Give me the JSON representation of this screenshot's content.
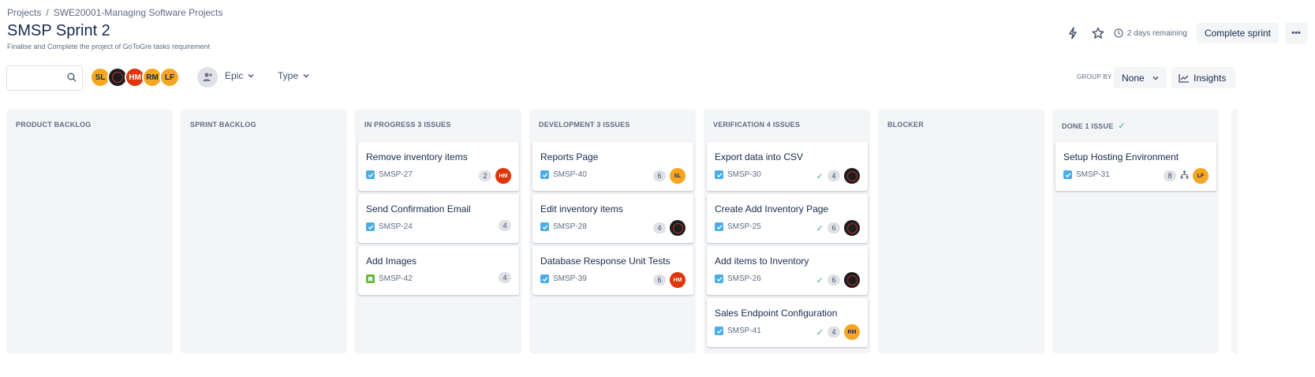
{
  "breadcrumb": {
    "items": [
      "Projects",
      "SWE20001-Managing Software Projects"
    ],
    "separator": "/"
  },
  "sprint": {
    "title": "SMSP Sprint 2",
    "goal": "Finalise and Complete the project of GoToGre tasks requirement"
  },
  "header_actions": {
    "remaining": "2 days remaining",
    "complete_label": "Complete sprint",
    "more_label": "•••"
  },
  "toolbar": {
    "search_placeholder": "",
    "avatars": [
      {
        "initials": "SL",
        "color": "#f6a623"
      },
      {
        "initials": "",
        "color": "#1d1d1d"
      },
      {
        "initials": "HM",
        "color": "#de350b"
      },
      {
        "initials": "RM",
        "color": "#f6a623"
      },
      {
        "initials": "LF",
        "color": "#f6a623"
      }
    ],
    "filter_epic": "Epic",
    "filter_type": "Type",
    "group_by_label": "GROUP BY",
    "group_by_value": "None",
    "insights_label": "Insights"
  },
  "columns": [
    {
      "name": "PRODUCT BACKLOG",
      "cards": []
    },
    {
      "name": "SPRINT BACKLOG",
      "cards": []
    },
    {
      "name": "IN PROGRESS 3 ISSUES",
      "cards": [
        {
          "title": "Remove inventory items",
          "key": "SMSP-27",
          "type": "task",
          "points": "2",
          "assignee": "HM",
          "done": false
        },
        {
          "title": "Send Confirmation Email",
          "key": "SMSP-24",
          "type": "task",
          "points": "4",
          "assignee": "",
          "done": false
        },
        {
          "title": "Add Images",
          "key": "SMSP-42",
          "type": "story",
          "points": "4",
          "assignee": "",
          "done": false
        }
      ]
    },
    {
      "name": "DEVELOPMENT 3 ISSUES",
      "cards": [
        {
          "title": "Reports Page",
          "key": "SMSP-40",
          "type": "task",
          "points": "6",
          "assignee": "SL",
          "done": false
        },
        {
          "title": "Edit inventory items",
          "key": "SMSP-28",
          "type": "task",
          "points": "4",
          "assignee": "dark",
          "done": false
        },
        {
          "title": "Database Response Unit Tests",
          "key": "SMSP-39",
          "type": "task",
          "points": "6",
          "assignee": "HM",
          "done": false
        }
      ]
    },
    {
      "name": "VERIFICATION 4 ISSUES",
      "cards": [
        {
          "title": "Export data into CSV",
          "key": "SMSP-30",
          "type": "task",
          "points": "4",
          "assignee": "dark",
          "done": true
        },
        {
          "title": "Create Add Inventory Page",
          "key": "SMSP-25",
          "type": "task",
          "points": "6",
          "assignee": "dark",
          "done": true
        },
        {
          "title": "Add items to Inventory",
          "key": "SMSP-26",
          "type": "task",
          "points": "6",
          "assignee": "dark",
          "done": true
        },
        {
          "title": "Sales Endpoint Configuration",
          "key": "SMSP-41",
          "type": "task",
          "points": "4",
          "assignee": "RM",
          "done": true
        }
      ]
    },
    {
      "name": "BLOCKER",
      "cards": []
    },
    {
      "name": "DONE 1 ISSUE",
      "done_column": true,
      "cards": [
        {
          "title": "Setup Hosting Environment",
          "key": "SMSP-31",
          "type": "task",
          "points": "8",
          "assignee": "LF",
          "done": false,
          "has_children": true
        }
      ]
    }
  ]
}
